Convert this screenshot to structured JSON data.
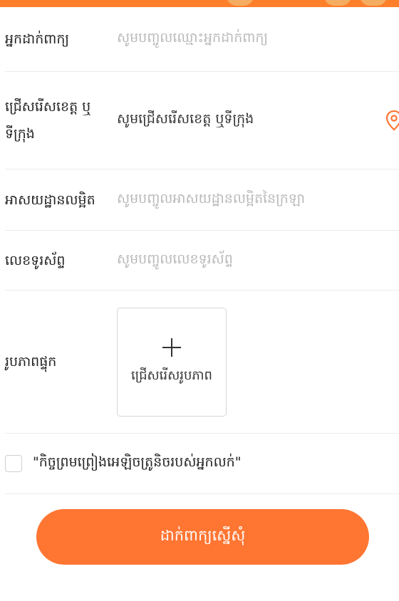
{
  "colors": {
    "accent": "#ff7532",
    "top_strip": "#ff7f2a",
    "placeholder": "#b9b9b9",
    "divider": "#ececec"
  },
  "form": {
    "applicant_name": {
      "label": "អ្នកដាក់ពាក្យ",
      "placeholder": "សូមបញ្ចូលឈ្មោះអ្នកដាក់ពាក្យ"
    },
    "province": {
      "label_line1": "ជ្រើសរើសខេត្ត ឬ",
      "label_line2": "ទីក្រុង",
      "value": "សូមជ្រើសរើសខេត្ត ឬទីក្រុង",
      "icon": "location-pin-icon"
    },
    "address": {
      "label": "អាសយដ្ឋានលម្អិត",
      "placeholder": "សូមបញ្ចូលអាសយដ្ឋានលម្អិតនៃក្រឡា"
    },
    "phone": {
      "label": "លេខទូរស័ព្ទ",
      "placeholder": "សូមបញ្ចូលលេខទូរស័ព្ទ"
    },
    "photo": {
      "label": "រូបភាពផ្ទុក",
      "upload_text": "ជ្រើសរើសរូបភាព",
      "icon": "plus-icon"
    },
    "agreement": {
      "text": "\"កិច្ចព្រមព្រៀងអេឡិចត្រូនិចរបស់អ្នកលក់\"",
      "checked": false
    }
  },
  "submit": {
    "label": "ដាក់ពាក្យស្នើសុំ"
  }
}
